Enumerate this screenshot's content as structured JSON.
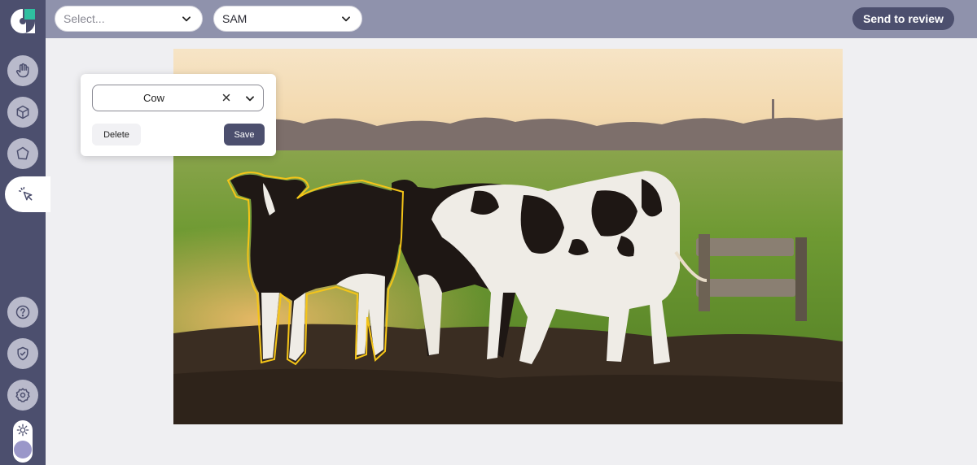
{
  "header": {
    "select_a": {
      "value": "Select...",
      "icon": "chevron-down-icon"
    },
    "select_b": {
      "value": "SAM",
      "icon": "chevron-down-icon"
    },
    "review_label": "Send to review"
  },
  "sidebar": {
    "logo": "app-logo",
    "tools": [
      {
        "icon": "hand-icon"
      },
      {
        "icon": "cube-icon"
      },
      {
        "icon": "polygon-icon"
      },
      {
        "icon": "cursor-click-icon",
        "active": true
      }
    ],
    "bottom": [
      {
        "icon": "help-icon"
      },
      {
        "icon": "shield-icon"
      },
      {
        "icon": "gear-icon"
      }
    ],
    "theme_toggle": {
      "icon": "sun-icon"
    }
  },
  "annotation_popup": {
    "label_value": "Cow",
    "delete_label": "Delete",
    "save_label": "Save"
  },
  "colors": {
    "accent": "#4c4f6e",
    "topbar": "#8f92ac",
    "mask_outline": "#f5c518"
  }
}
